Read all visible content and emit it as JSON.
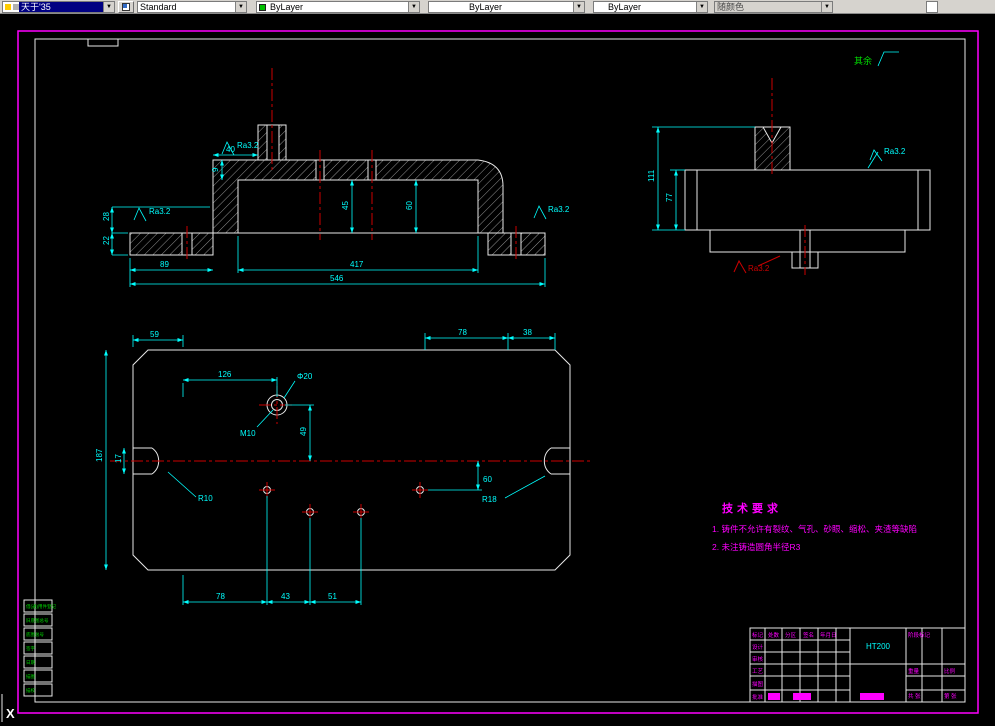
{
  "toolbar": {
    "layer_combo": "天于'35",
    "style_combo": "Standard",
    "color_combo": "ByLayer",
    "linetype_combo": "ByLayer",
    "lineweight_combo": "ByLayer",
    "plotstyle_combo": "随颜色",
    "dropdown_arrow": "▼"
  },
  "canvas": {
    "ucs_x": "X",
    "ra_label": "Ra3.2",
    "surface_note_prefix": "其余",
    "tech_req": {
      "title": "技术要求",
      "item1": "1. 铸件不允许有裂纹、气孔、砂眼、缩松、夹渣等缺陷",
      "item2": "2. 未注铸造圆角半径R3"
    },
    "dims": {
      "front": {
        "w417": "417",
        "w546": "546",
        "w89": "89",
        "h22": "22",
        "h28": "28",
        "w40": "40",
        "h9": "9",
        "h45": "45",
        "h60": "60"
      },
      "side": {
        "h111": "111",
        "h77": "77"
      },
      "plan": {
        "w126": "126",
        "dia20": "Φ20",
        "m10": "M10",
        "h49": "49",
        "h60": "60",
        "w59": "59",
        "w78t": "78",
        "w38": "38",
        "h187": "187",
        "h17": "17",
        "r10": "R10",
        "r18": "R18",
        "w78b": "78",
        "w43": "43",
        "w51": "51"
      }
    },
    "frame_labels": [
      "借(通)用件登记",
      "旧底图总号",
      "底图总号",
      "签字",
      "日期",
      "描图",
      "描校"
    ],
    "title_block": {
      "material": "HT200",
      "cells": {
        "biaoji": "标记",
        "chushu": "处数",
        "fenqu": "分区",
        "qianming": "签名",
        "nianyueri": "年月日",
        "sheji": "设计",
        "shenhe": "审核",
        "gongyi": "工艺",
        "miaotu": "描图",
        "pizhun": "批准",
        "jieduan": "阶段标记",
        "zhongliang": "重量",
        "bili": "比例",
        "gong": "共 张",
        "di": "第 张"
      }
    }
  }
}
